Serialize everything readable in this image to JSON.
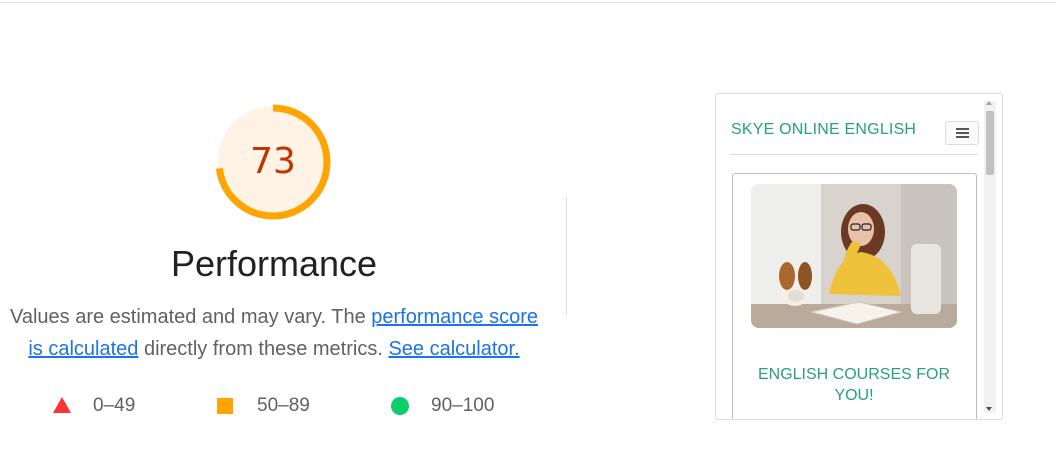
{
  "performance": {
    "score": "73",
    "score_fraction": 0.73,
    "title": "Performance",
    "description_prefix": "Values are estimated and may vary. The ",
    "score_link": "performance score is calculated",
    "description_middle": " directly from these metrics. ",
    "calculator_link": "See calculator.",
    "colors": {
      "average": "#ffa400",
      "average_text": "#c33300",
      "average_bg": "#fff3e6"
    }
  },
  "legend": [
    {
      "range": "0–49",
      "shape": "triangle-icon",
      "color": "#ff3333"
    },
    {
      "range": "50–89",
      "shape": "square-icon",
      "color": "#ffa400"
    },
    {
      "range": "90–100",
      "shape": "circle-icon",
      "color": "#0cce6b"
    }
  ],
  "screenshot": {
    "brand": "SKYE ONLINE ENGLISH",
    "menu_icon": "hamburger-menu-icon",
    "card_title": "ENGLISH COURSES FOR YOU!",
    "accent": "#28a17a"
  }
}
